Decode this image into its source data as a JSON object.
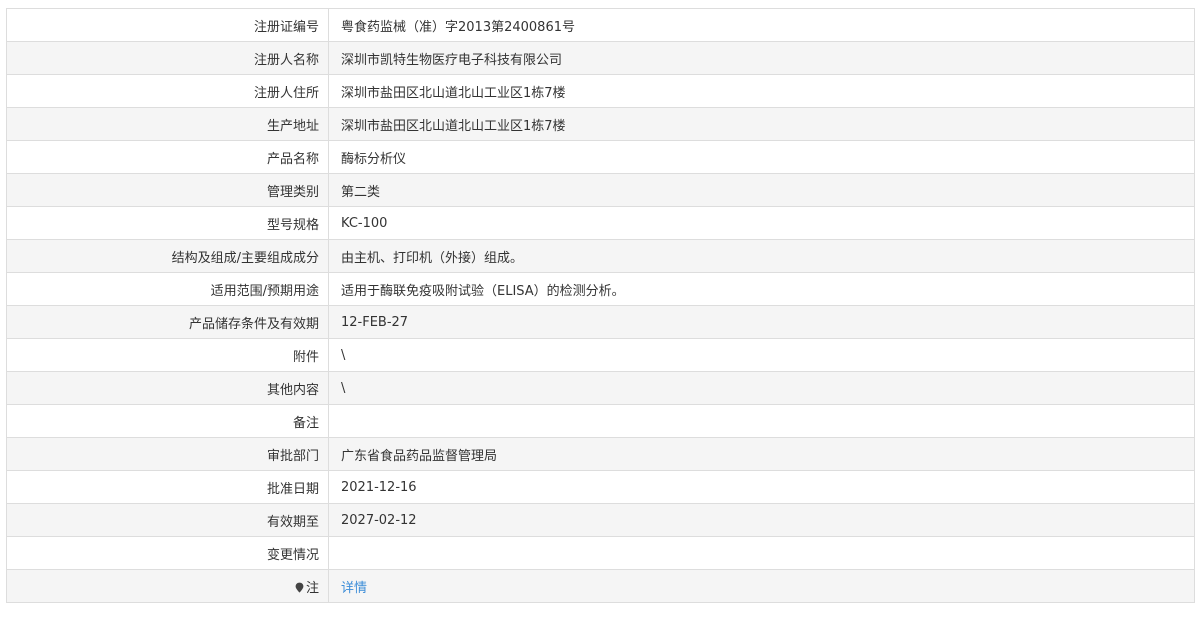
{
  "rows": [
    {
      "label": "注册证编号",
      "value": "粤食药监械（准）字2013第2400861号"
    },
    {
      "label": "注册人名称",
      "value": "深圳市凯特生物医疗电子科技有限公司"
    },
    {
      "label": "注册人住所",
      "value": "深圳市盐田区北山道北山工业区1栋7楼"
    },
    {
      "label": "生产地址",
      "value": "深圳市盐田区北山道北山工业区1栋7楼"
    },
    {
      "label": "产品名称",
      "value": "酶标分析仪"
    },
    {
      "label": "管理类别",
      "value": "第二类"
    },
    {
      "label": "型号规格",
      "value": "KC-100"
    },
    {
      "label": "结构及组成/主要组成成分",
      "value": "由主机、打印机（外接）组成。"
    },
    {
      "label": "适用范围/预期用途",
      "value": "适用于酶联免疫吸附试验（ELISA）的检测分析。"
    },
    {
      "label": "产品储存条件及有效期",
      "value": "12-FEB-27"
    },
    {
      "label": "附件",
      "value": "\\"
    },
    {
      "label": "其他内容",
      "value": "\\"
    },
    {
      "label": "备注",
      "value": ""
    },
    {
      "label": "审批部门",
      "value": "广东省食品药品监督管理局"
    },
    {
      "label": "批准日期",
      "value": "2021-12-16"
    },
    {
      "label": "有效期至",
      "value": "2027-02-12"
    },
    {
      "label": "变更情况",
      "value": ""
    }
  ],
  "note": {
    "icon": "pin-icon",
    "label": "注",
    "link_text": "详情"
  }
}
